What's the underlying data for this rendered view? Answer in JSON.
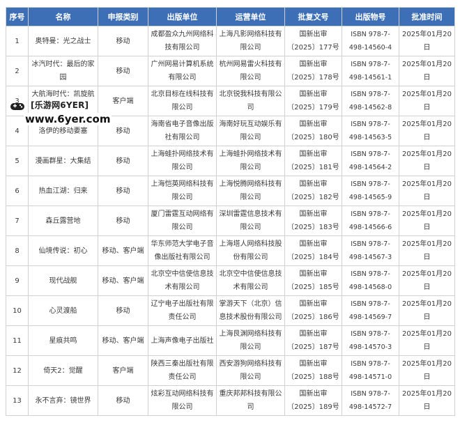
{
  "table": {
    "headers": [
      "序号",
      "名称",
      "申报类别",
      "出版单位",
      "运营单位",
      "批复文号",
      "出版物号",
      "批准时间"
    ],
    "rows": [
      [
        "1",
        "奥特曼：光之战士",
        "移动",
        "成都盈众九州网络科技有限公司",
        "上海凡影网络科技有限公司",
        "国新出审〔2025〕177号",
        "ISBN 978-7-498-14560-4",
        "2025年01月20日"
      ],
      [
        "2",
        "冰汽时代：最后的家园",
        "移动",
        "广州网易计算机系统有限公司",
        "杭州网易雷火科技有限公司",
        "国新出审〔2025〕178号",
        "ISBN 978-7-498-14561-1",
        "2025年01月20日"
      ],
      [
        "3",
        "大航海时代：凯旋航线",
        "客户端",
        "北京目标在线科技有限公司",
        "北京锐我科技有限公司",
        "国新出审〔2025〕179号",
        "ISBN 978-7-498-14562-8",
        "2025年01月20日"
      ],
      [
        "4",
        "洛伊的移动要塞",
        "移动",
        "海南省电子音像出版社有限公司",
        "海南好玩互动娱乐有限公司",
        "国新出审〔2025〕180号",
        "ISBN 978-7-498-14563-5",
        "2025年01月20日"
      ],
      [
        "5",
        "漫画群星：大集结",
        "移动",
        "上海蛙扑网络技术有限公司",
        "上海蛙扑网络技术有限公司",
        "国新出审〔2025〕181号",
        "ISBN 978-7-498-14564-2",
        "2025年01月20日"
      ],
      [
        "6",
        "热血江湖：归来",
        "移动",
        "上海恺英网络科技有限公司",
        "上海悦腾网络科技有限公司",
        "国新出审〔2025〕182号",
        "ISBN 978-7-498-14565-9",
        "2025年01月20日"
      ],
      [
        "7",
        "森丘露营地",
        "移动",
        "厦门雷霆互动网络有限公司",
        "深圳雷霆信息技术有限公司",
        "国新出审〔2025〕183号",
        "ISBN 978-7-498-14566-6",
        "2025年01月20日"
      ],
      [
        "8",
        "仙境传说：初心",
        "移动、客户端",
        "华东师范大学电子音像出版社有限公司",
        "上海塔人网络科技股份有限公司",
        "国新出审〔2025〕184号",
        "ISBN 978-7-498-14567-3",
        "2025年01月20日"
      ],
      [
        "9",
        "现代战舰",
        "移动、客户端",
        "北京空中信使信息技术有限公司",
        "北京空中信使信息技术有限公司",
        "国新出审〔2025〕185号",
        "ISBN 978-7-498-14568-0",
        "2025年01月20日"
      ],
      [
        "10",
        "心灵渡船",
        "移动",
        "辽宁电子出版社有限责任公司",
        "掌游天下（北京）信息技术股份有限公司",
        "国新出审〔2025〕186号",
        "ISBN 978-7-498-14569-7",
        "2025年01月20日"
      ],
      [
        "11",
        "星痕共鸣",
        "移动、客户端",
        "上海声像电子出版社",
        "上海艮渊网络科技有限公司",
        "国新出审〔2025〕187号",
        "ISBN 978-7-498-14570-3",
        "2025年01月20日"
      ],
      [
        "12",
        "倚天2：觉醒",
        "客户端",
        "陕西三秦出版社有限责任公司",
        "西安游狗网络科技有限公司",
        "国新出审〔2025〕188号",
        "ISBN 978-7-498-14571-0",
        "2025年01月20日"
      ],
      [
        "13",
        "永不言弃：镜世界",
        "移动",
        "炫彩互动网络科技有限公司",
        "重庆邦邦科技有限公司",
        "国新出审〔2025〕189号",
        "ISBN 978-7-498-14572-7",
        "2025年01月20日"
      ]
    ]
  },
  "watermark": {
    "tag": "[乐游网6YER]",
    "url": "www.6yer.com",
    "icon": "controller-icon"
  },
  "colors": {
    "header_bg": "#3d6fb6",
    "header_text": "#ffffff",
    "border": "#d0d0d0"
  }
}
